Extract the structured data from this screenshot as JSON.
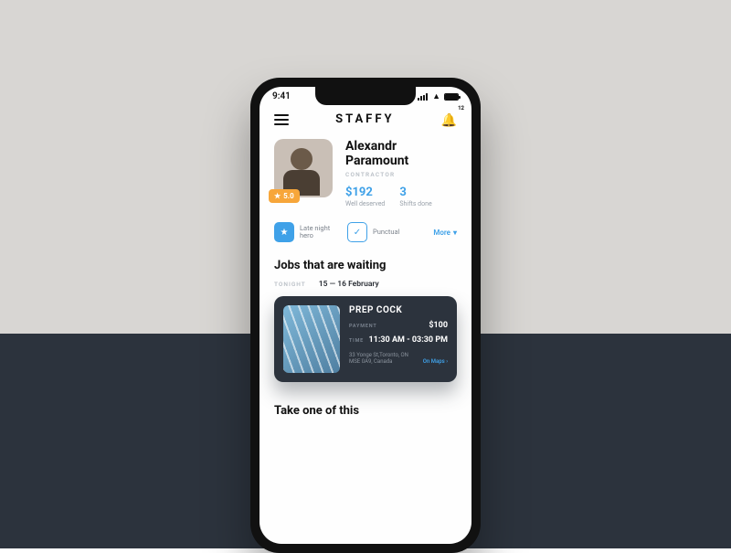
{
  "status": {
    "time": "9:41"
  },
  "header": {
    "brand": "STAFFY",
    "notif_count": "12"
  },
  "profile": {
    "name_line1": "Alexandr",
    "name_line2": "Paramount",
    "role": "CONTRACTOR",
    "rating": "5.0",
    "stats": [
      {
        "value": "$192",
        "label": "Well deserved"
      },
      {
        "value": "3",
        "label": "Shifts done"
      }
    ]
  },
  "tags": {
    "items": [
      {
        "label": "Late night hero"
      },
      {
        "label": "Punctual"
      }
    ],
    "more": "More"
  },
  "jobs": {
    "heading": "Jobs that are waiting",
    "date_label": "TONIGHT",
    "date_range": "15 — 16 February",
    "card": {
      "title": "PREP COCK",
      "payment_label": "PAYMENT",
      "payment": "$100",
      "time_label": "TIME",
      "time": "11:30 AM - 03:30 PM",
      "address": "33 Yonge St,Toronto, ON MSE 0A9, Canada",
      "maps": "On Maps"
    }
  },
  "take": {
    "heading": "Take one of this"
  }
}
